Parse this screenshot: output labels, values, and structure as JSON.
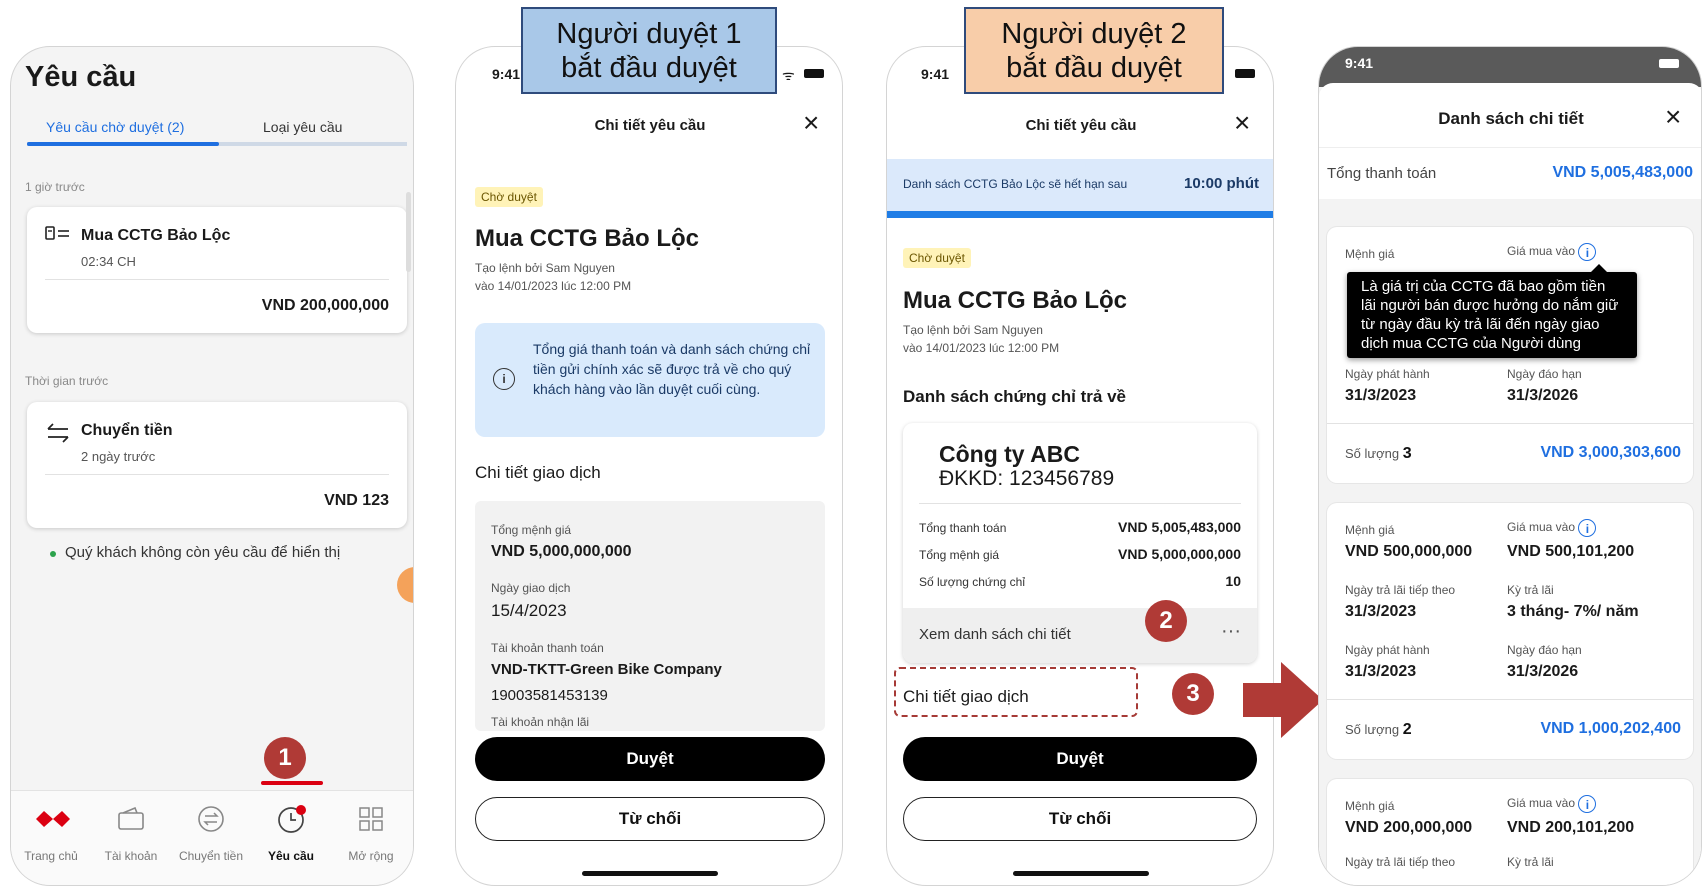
{
  "labels": {
    "approver1": "Người duyệt 1\nbắt đầu duyệt",
    "approver2": "Người duyệt 2\nbắt đầu duyệt",
    "step1": "1",
    "step2": "2",
    "step3": "3"
  },
  "colors": {
    "brand_red": "#db0011",
    "accent_blue": "#1f6fe0",
    "step_badge": "#b03a36",
    "approver1_box": "#a9c8e8",
    "approver2_box": "#f8cda9"
  },
  "p1": {
    "title": "Yêu cầu",
    "tabs": [
      "Yêu cầu chờ duyệt (2)",
      "Loại yêu cầu"
    ],
    "section1": "1 giờ trước",
    "card1": {
      "icon": "document-icon",
      "title": "Mua CCTG Bảo Lộc",
      "time": "02:34 CH",
      "amount": "VND 200,000,000"
    },
    "section2": "Thời gian trước",
    "card2": {
      "icon": "transfer-icon",
      "title": "Chuyển tiền",
      "time": "2 ngày trước",
      "amount": "VND 123"
    },
    "empty_note": "Quý khách không còn yêu cầu để hiển thị",
    "nav": [
      "Trang chủ",
      "Tài khoản",
      "Chuyển tiền",
      "Yêu cầu",
      "Mở rộng"
    ]
  },
  "p2": {
    "time": "9:41",
    "header": "Chi tiết yêu cầu",
    "close": "×",
    "status": "Chờ duyệt",
    "title": "Mua CCTG Bảo Lộc",
    "created_by": "Tạo lệnh bởi Sam Nguyen",
    "created_at": "vào 14/01/2023 lúc 12:00 PM",
    "info": "Tổng giá thanh toán và danh sách chứng chỉ tiền gửi chính xác sẽ được trả về cho quý khách hàng vào lần duyệt cuối cùng.",
    "section": "Chi tiết giao dịch",
    "fields": [
      {
        "label": "Tổng mệnh giá",
        "value": "VND 5,000,000,000"
      },
      {
        "label": "Ngày giao dịch",
        "value": "15/4/2023"
      },
      {
        "label": "Tài khoản thanh toán",
        "value": "VND-TKTT-Green Bike Company",
        "value2": "19003581453139"
      },
      {
        "label": "Tài khoản nhận lãi",
        "value": ""
      }
    ],
    "approve": "Duyệt",
    "reject": "Từ chối"
  },
  "p3": {
    "time": "9:41",
    "header": "Chi tiết yêu cầu",
    "close": "×",
    "banner_text": "Danh sách CCTG Bảo Lộc sẽ hết hạn sau",
    "banner_timer": "10:00 phút",
    "status": "Chờ duyệt",
    "title": "Mua CCTG Bảo Lộc",
    "created_by": "Tạo lệnh bởi Sam Nguyen",
    "created_at": "vào 14/01/2023 lúc 12:00 PM",
    "list_title": "Danh sách chứng chỉ trả về",
    "company": "Công ty ABC",
    "reg": "ĐKKD: 123456789",
    "rows": [
      {
        "label": "Tổng thanh toán",
        "value": "VND 5,005,483,000"
      },
      {
        "label": "Tổng mệnh giá",
        "value": "VND 5,000,000,000"
      },
      {
        "label": "Số lượng chứng chỉ",
        "value": "10"
      }
    ],
    "view_list": "Xem danh sách chi tiết",
    "more": "···",
    "section": "Chi tiết giao dịch",
    "approve": "Duyệt",
    "reject": "Từ chối"
  },
  "p4": {
    "time": "9:41",
    "header": "Danh sách chi tiết",
    "close": "×",
    "total_label": "Tổng thanh toán",
    "total_value": "VND 5,005,483,000",
    "tooltip": "Là giá trị của CCTG đã bao gồm tiền lãi người bán được hưởng do nắm giữ từ ngày đầu kỳ trả lãi đến ngày giao dịch mua CCTG của Người dùng",
    "card1": {
      "face_label": "Mệnh giá",
      "buy_label": "Giá mua vào",
      "issue_label": "Ngày phát hành",
      "issue": "31/3/2023",
      "maturity_label": "Ngày đáo hạn",
      "maturity": "31/3/2026",
      "qty_label": "Số lượng",
      "qty": "3",
      "total": "VND 3,000,303,600"
    },
    "card2": {
      "face_label": "Mệnh giá",
      "face": "VND 500,000,000",
      "buy_label": "Giá mua vào",
      "buy": "VND 500,101,200",
      "next_label": "Ngày trả lãi tiếp theo",
      "next": "31/3/2023",
      "period_label": "Kỳ trả lãi",
      "period": "3 tháng- 7%/ năm",
      "issue_label": "Ngày phát hành",
      "issue": "31/3/2023",
      "maturity_label": "Ngày đáo hạn",
      "maturity": "31/3/2026",
      "qty_label": "Số lượng",
      "qty": "2",
      "total": "VND 1,000,202,400"
    },
    "card3": {
      "face_label": "Mệnh giá",
      "face": "VND 200,000,000",
      "buy_label": "Giá mua vào",
      "buy": "VND 200,101,200",
      "next_label": "Ngày trả lãi tiếp theo",
      "period_label": "Kỳ trả lãi"
    }
  }
}
